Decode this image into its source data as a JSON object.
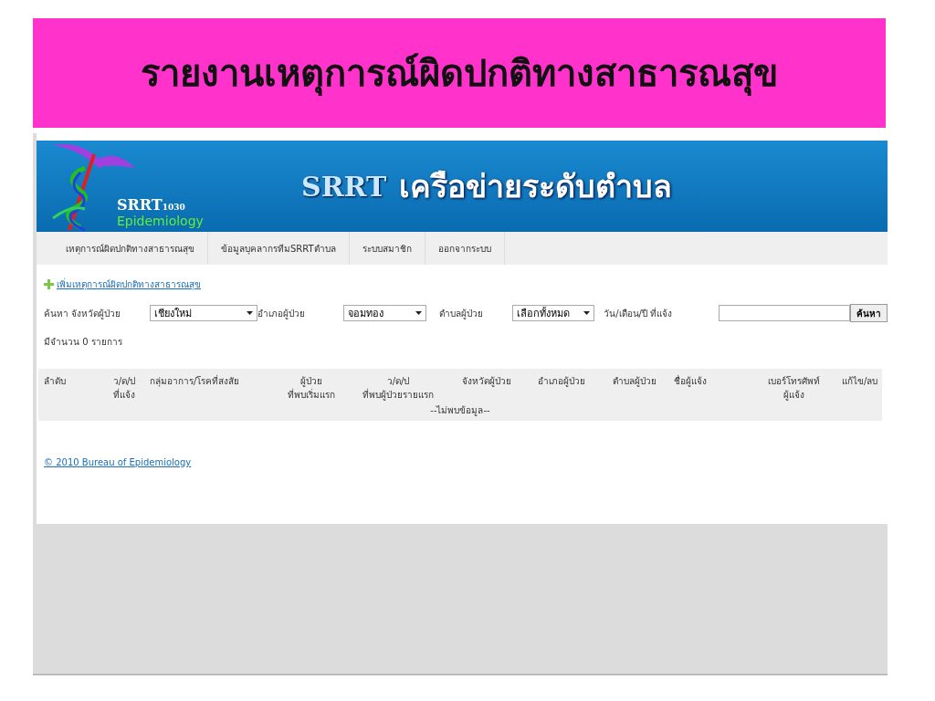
{
  "slide_title": "รายงานเหตุการณ์ผิดปกติทางสาธารณสุข",
  "banner": {
    "logo_title": "SRRT",
    "logo_number": "1030",
    "logo_subtitle": "Epidemiology",
    "brand": "SRRT",
    "title": "เครือข่ายระดับตำบล"
  },
  "nav": [
    {
      "label": "เหตุการณ์ผิดปกติทางสาธารณสุข",
      "selected": false
    },
    {
      "label": "ข้อมูลบุคลากรทีมSRRTตำบล",
      "selected": false
    },
    {
      "label": "ระบบสมาชิก",
      "selected": false
    },
    {
      "label": "ออกจากระบบ",
      "selected": false
    }
  ],
  "add_link": "เพิ่มเหตุการณ์ผิดปกติทางสาธารณสุข",
  "search": {
    "label": "ค้นหา จังหวัดผู้ป่วย",
    "province": "เชียงใหม่",
    "district_label": "อำเภอผู้ป่วย",
    "district": "จอมทอง",
    "subdistrict_label": "ตำบลผู้ป่วย",
    "subdistrict": "เลือกทั้งหมด",
    "date_label": "วัน/เดือน/ปี ที่แจ้ง",
    "button": "ค้นหา"
  },
  "count": "มีจำนวน 0 รายการ",
  "table": {
    "columns": [
      "ลำดับ",
      "ว/ด/ป\nที่แจ้ง",
      "กลุ่มอาการ/โรคที่สงสัย",
      "ผู้ป่วย\nที่พบเริ่มแรก",
      "ว/ด/ป\nที่พบผู้ป่วยรายแรก",
      "จังหวัดผู้ป่วย",
      "อำเภอผู้ป่วย",
      "ตำบลผู้ป่วย",
      "ชื่อผู้แจ้ง",
      "เบอร์โทรศัพท์\nผู้แจ้ง",
      "แก้ไข/ลบ"
    ],
    "empty_message": "--ไม่พบข้อมูล--"
  },
  "footer": "© 2010 Bureau of Epidemiology"
}
